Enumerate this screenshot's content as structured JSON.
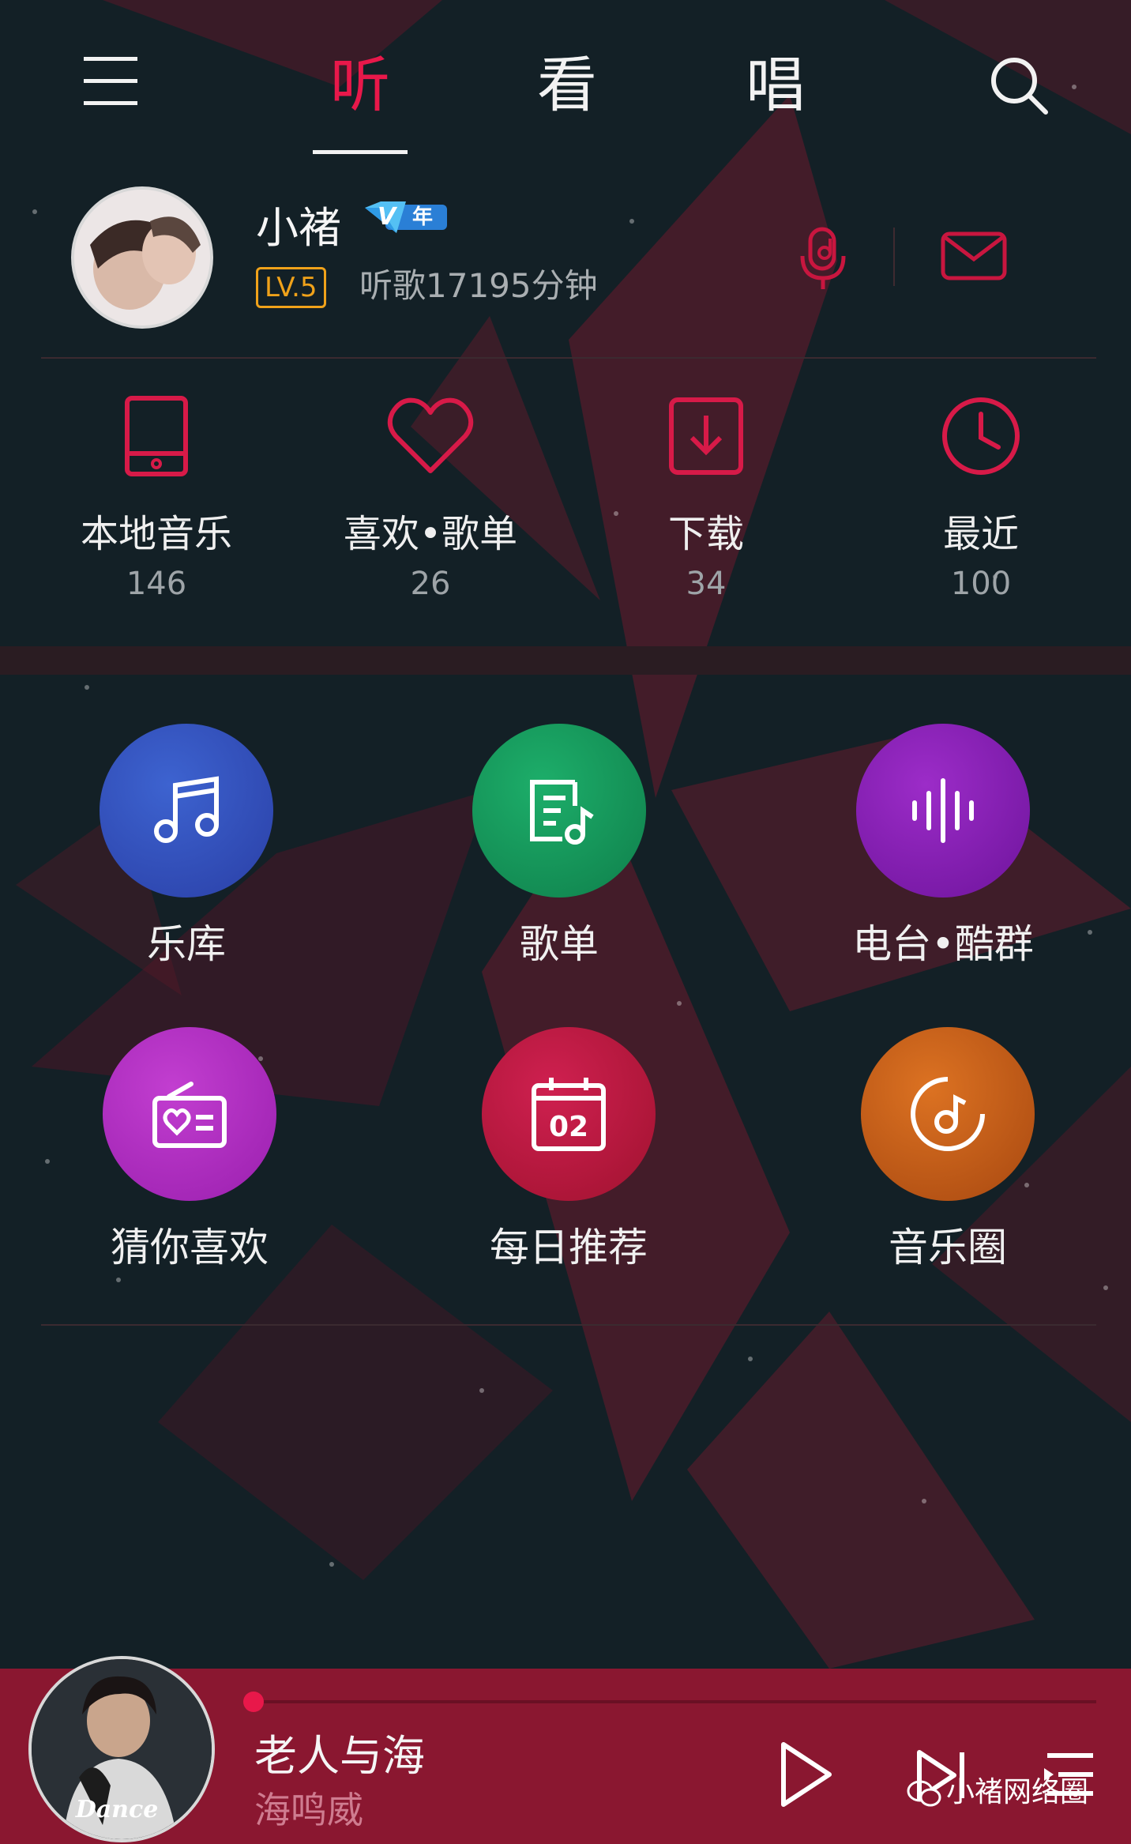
{
  "colors": {
    "accent": "#e8184a",
    "background": "#132026",
    "player_bg": "#8a1730",
    "level": "#f0a21a"
  },
  "header": {
    "menu_icon": "hamburger-menu-icon",
    "tabs": [
      {
        "label": "听",
        "active": true
      },
      {
        "label": "看",
        "active": false
      },
      {
        "label": "唱",
        "active": false
      }
    ],
    "search_icon": "search-icon"
  },
  "profile": {
    "name": "小褚",
    "vip_badge": {
      "v": "V",
      "text": "年"
    },
    "level": "LV.5",
    "listen_time": "听歌17195分钟",
    "actions": [
      {
        "icon": "voice-recognition-icon"
      },
      {
        "icon": "mail-icon"
      }
    ]
  },
  "quick_entries": [
    {
      "label": "本地音乐",
      "count": "146",
      "icon": "phone-icon"
    },
    {
      "label": "喜欢•歌单",
      "count": "26",
      "icon": "heart-icon"
    },
    {
      "label": "下载",
      "count": "34",
      "icon": "download-icon"
    },
    {
      "label": "最近",
      "count": "100",
      "icon": "clock-icon"
    }
  ],
  "grid": [
    {
      "label": "乐库",
      "icon": "music-note-icon",
      "color": "#2f4db6"
    },
    {
      "label": "歌单",
      "icon": "playlist-icon",
      "color": "#14955a"
    },
    {
      "label": "电台•酷群",
      "icon": "sound-wave-icon",
      "color": "#8a1fb4"
    },
    {
      "label": "猜你喜欢",
      "icon": "radio-heart-icon",
      "color": "#b22cc0"
    },
    {
      "label": "每日推荐",
      "icon": "calendar-icon",
      "color": "#b91840",
      "calendar_day": "02"
    },
    {
      "label": "音乐圈",
      "icon": "music-disc-icon",
      "color": "#c8621a"
    }
  ],
  "player": {
    "song": "老人与海",
    "artist": "海鸣威",
    "progress": 0.0,
    "controls": [
      "play-icon",
      "next-icon",
      "playlist-queue-icon"
    ]
  },
  "watermark": "小褚网络圈"
}
